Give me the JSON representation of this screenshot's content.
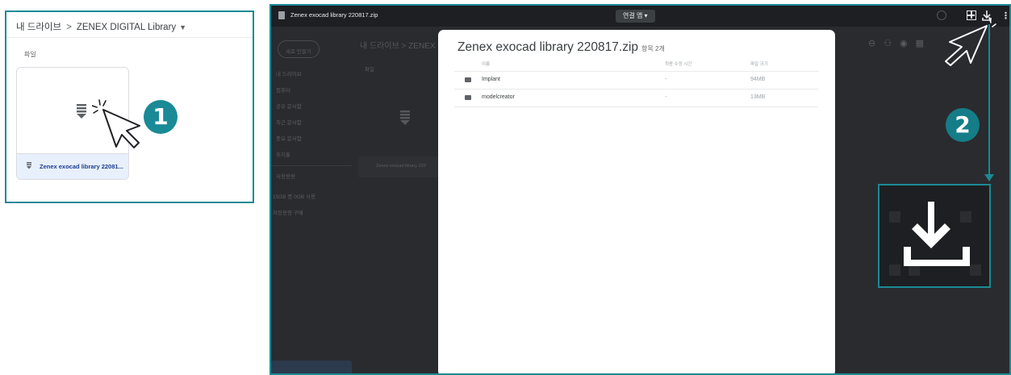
{
  "panel1": {
    "breadcrumb": {
      "root": "내 드라이브",
      "separator": ">",
      "folder": "ZENEX DIGITAL Library"
    },
    "files_label": "파일",
    "file_card": {
      "name": "Zenex exocad library 22081..."
    },
    "badge": "1"
  },
  "panel2": {
    "window_title": "Zenex exocad library 220817.zip",
    "open_with": "연결 앱 ▾",
    "modal": {
      "title": "Zenex exocad library 220817.zip",
      "item_count": "항목 2개",
      "columns": {
        "name": "이름",
        "modified": "최종 수정 시간",
        "size": "파일 크기"
      },
      "rows": [
        {
          "name": "Implant",
          "modified": "-",
          "size": "94MB"
        },
        {
          "name": "modelcreator",
          "modified": "-",
          "size": "13MB"
        }
      ]
    },
    "background": {
      "new_button": "새로 만들기",
      "breadcrumb": "내 드라이브 > ZENEX",
      "files_label": "파일",
      "sidebar": [
        "내 드라이브",
        "컴퓨터",
        "공유 문서함",
        "최근 문서함",
        "중요 문서함",
        "휴지통",
        "저장용량"
      ],
      "card_name": "Zenex exocad library 220",
      "storage": "15GB 중 0GB 사용",
      "buy_storage": "저장용량 구매"
    },
    "badge": "2"
  },
  "colors": {
    "accent": "#1a8a96",
    "dark_bg": "#2a2b2f",
    "modal_bg": "#ffffff"
  }
}
